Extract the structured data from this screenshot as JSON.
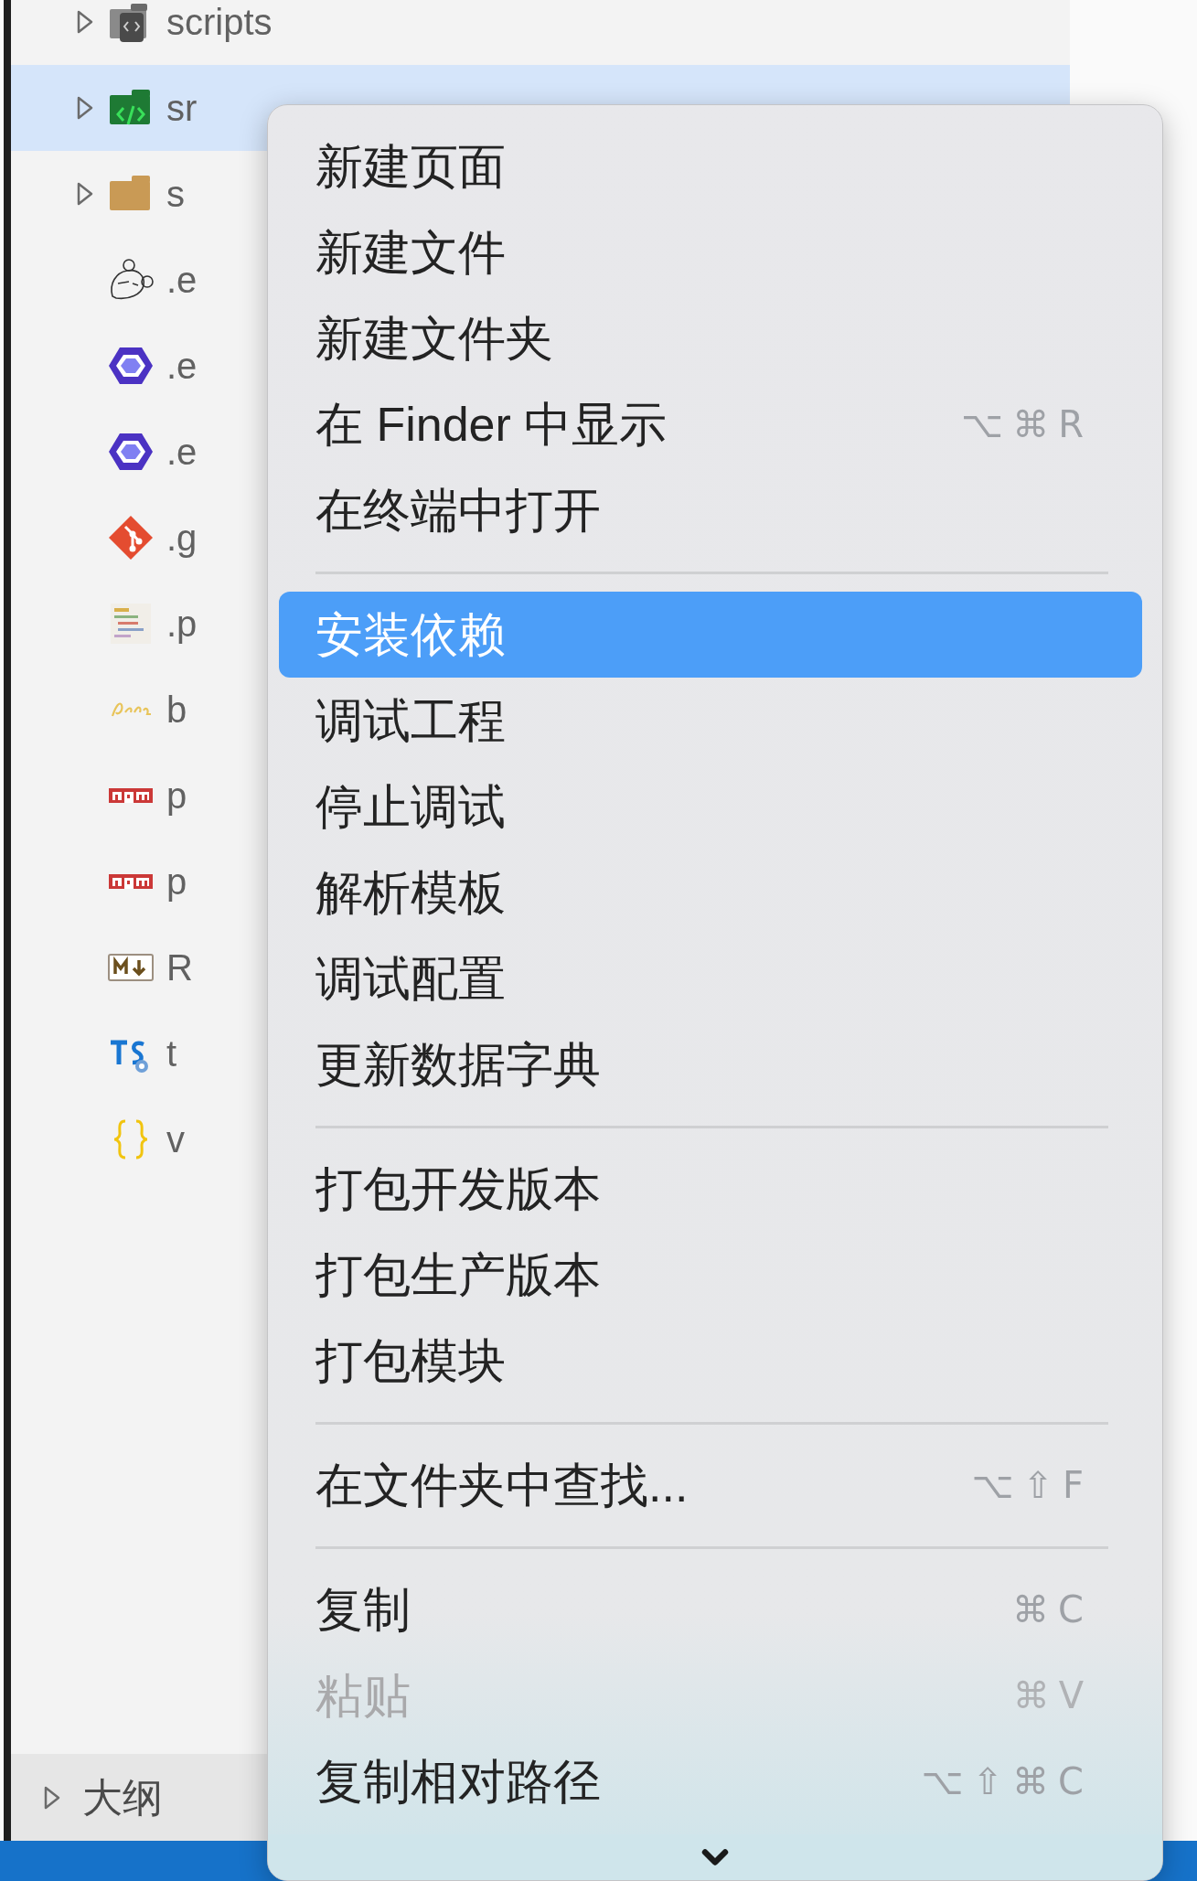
{
  "sidebar": {
    "items": [
      {
        "name": "scripts",
        "kind": "code-folder",
        "expanded": false,
        "selected": false
      },
      {
        "name": "sr",
        "kind": "source-folder",
        "expanded": false,
        "selected": true
      },
      {
        "name": "s",
        "kind": "folder",
        "expanded": false,
        "selected": false
      },
      {
        "name": ".e",
        "kind": "mouse",
        "selected": false
      },
      {
        "name": ".e",
        "kind": "hexagon",
        "selected": false
      },
      {
        "name": ".e",
        "kind": "hexagon",
        "selected": false
      },
      {
        "name": ".g",
        "kind": "git",
        "selected": false
      },
      {
        "name": ".p",
        "kind": "thumbnail",
        "selected": false
      },
      {
        "name": "b",
        "kind": "babel",
        "selected": false
      },
      {
        "name": "p",
        "kind": "npm",
        "selected": false
      },
      {
        "name": "p",
        "kind": "npm",
        "selected": false
      },
      {
        "name": "R",
        "kind": "markdown",
        "selected": false
      },
      {
        "name": "t",
        "kind": "typescript",
        "selected": false
      },
      {
        "name": "v",
        "kind": "json",
        "selected": false
      }
    ]
  },
  "outline": {
    "label": "大纲",
    "expanded": false
  },
  "context_menu": {
    "groups": [
      [
        {
          "label": "新建页面",
          "selected": false,
          "disabled": false
        },
        {
          "label": "新建文件",
          "selected": false,
          "disabled": false
        },
        {
          "label": "新建文件夹",
          "selected": false,
          "disabled": false
        },
        {
          "label": "在 Finder 中显示",
          "shortcut": "⌥⌘R",
          "selected": false,
          "disabled": false
        },
        {
          "label": "在终端中打开",
          "selected": false,
          "disabled": false
        }
      ],
      [
        {
          "label": "安装依赖",
          "selected": true,
          "disabled": false
        },
        {
          "label": "调试工程",
          "selected": false,
          "disabled": false
        },
        {
          "label": "停止调试",
          "selected": false,
          "disabled": false
        },
        {
          "label": "解析模板",
          "selected": false,
          "disabled": false
        },
        {
          "label": "调试配置",
          "selected": false,
          "disabled": false
        },
        {
          "label": "更新数据字典",
          "selected": false,
          "disabled": false
        }
      ],
      [
        {
          "label": "打包开发版本",
          "selected": false,
          "disabled": false
        },
        {
          "label": "打包生产版本",
          "selected": false,
          "disabled": false
        },
        {
          "label": "打包模块",
          "selected": false,
          "disabled": false
        }
      ],
      [
        {
          "label": "在文件夹中查找...",
          "shortcut": "⌥⇧F",
          "selected": false,
          "disabled": false
        }
      ],
      [
        {
          "label": "复制",
          "shortcut": "⌘C",
          "selected": false,
          "disabled": false
        },
        {
          "label": "粘贴",
          "shortcut": "⌘V",
          "selected": false,
          "disabled": true
        },
        {
          "label": "复制相对路径",
          "shortcut": "⌥⇧⌘C",
          "selected": false,
          "disabled": false
        }
      ]
    ]
  }
}
